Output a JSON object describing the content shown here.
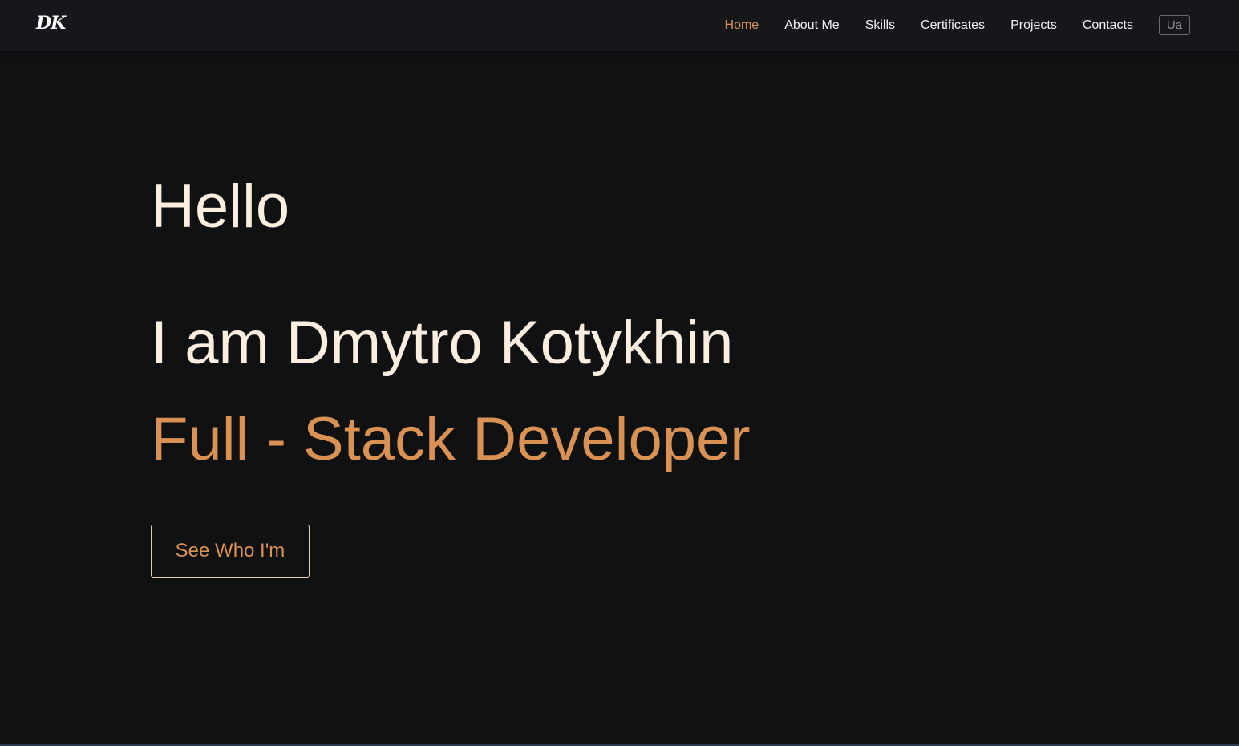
{
  "navbar": {
    "logo": "DK",
    "links": [
      {
        "label": "Home",
        "active": true
      },
      {
        "label": "About Me",
        "active": false
      },
      {
        "label": "Skills",
        "active": false
      },
      {
        "label": "Certificates",
        "active": false
      },
      {
        "label": "Projects",
        "active": false
      },
      {
        "label": "Contacts",
        "active": false
      }
    ],
    "language_button": "Ua"
  },
  "hero": {
    "greeting": "Hello",
    "name_line": "I am Dmytro Kotykhin",
    "role": "Full - Stack Developer",
    "cta_label": "See Who I'm"
  },
  "colors": {
    "background": "#101113",
    "navbar_background": "#16171a",
    "accent": "#d99154",
    "text_primary": "#fcefdf"
  }
}
